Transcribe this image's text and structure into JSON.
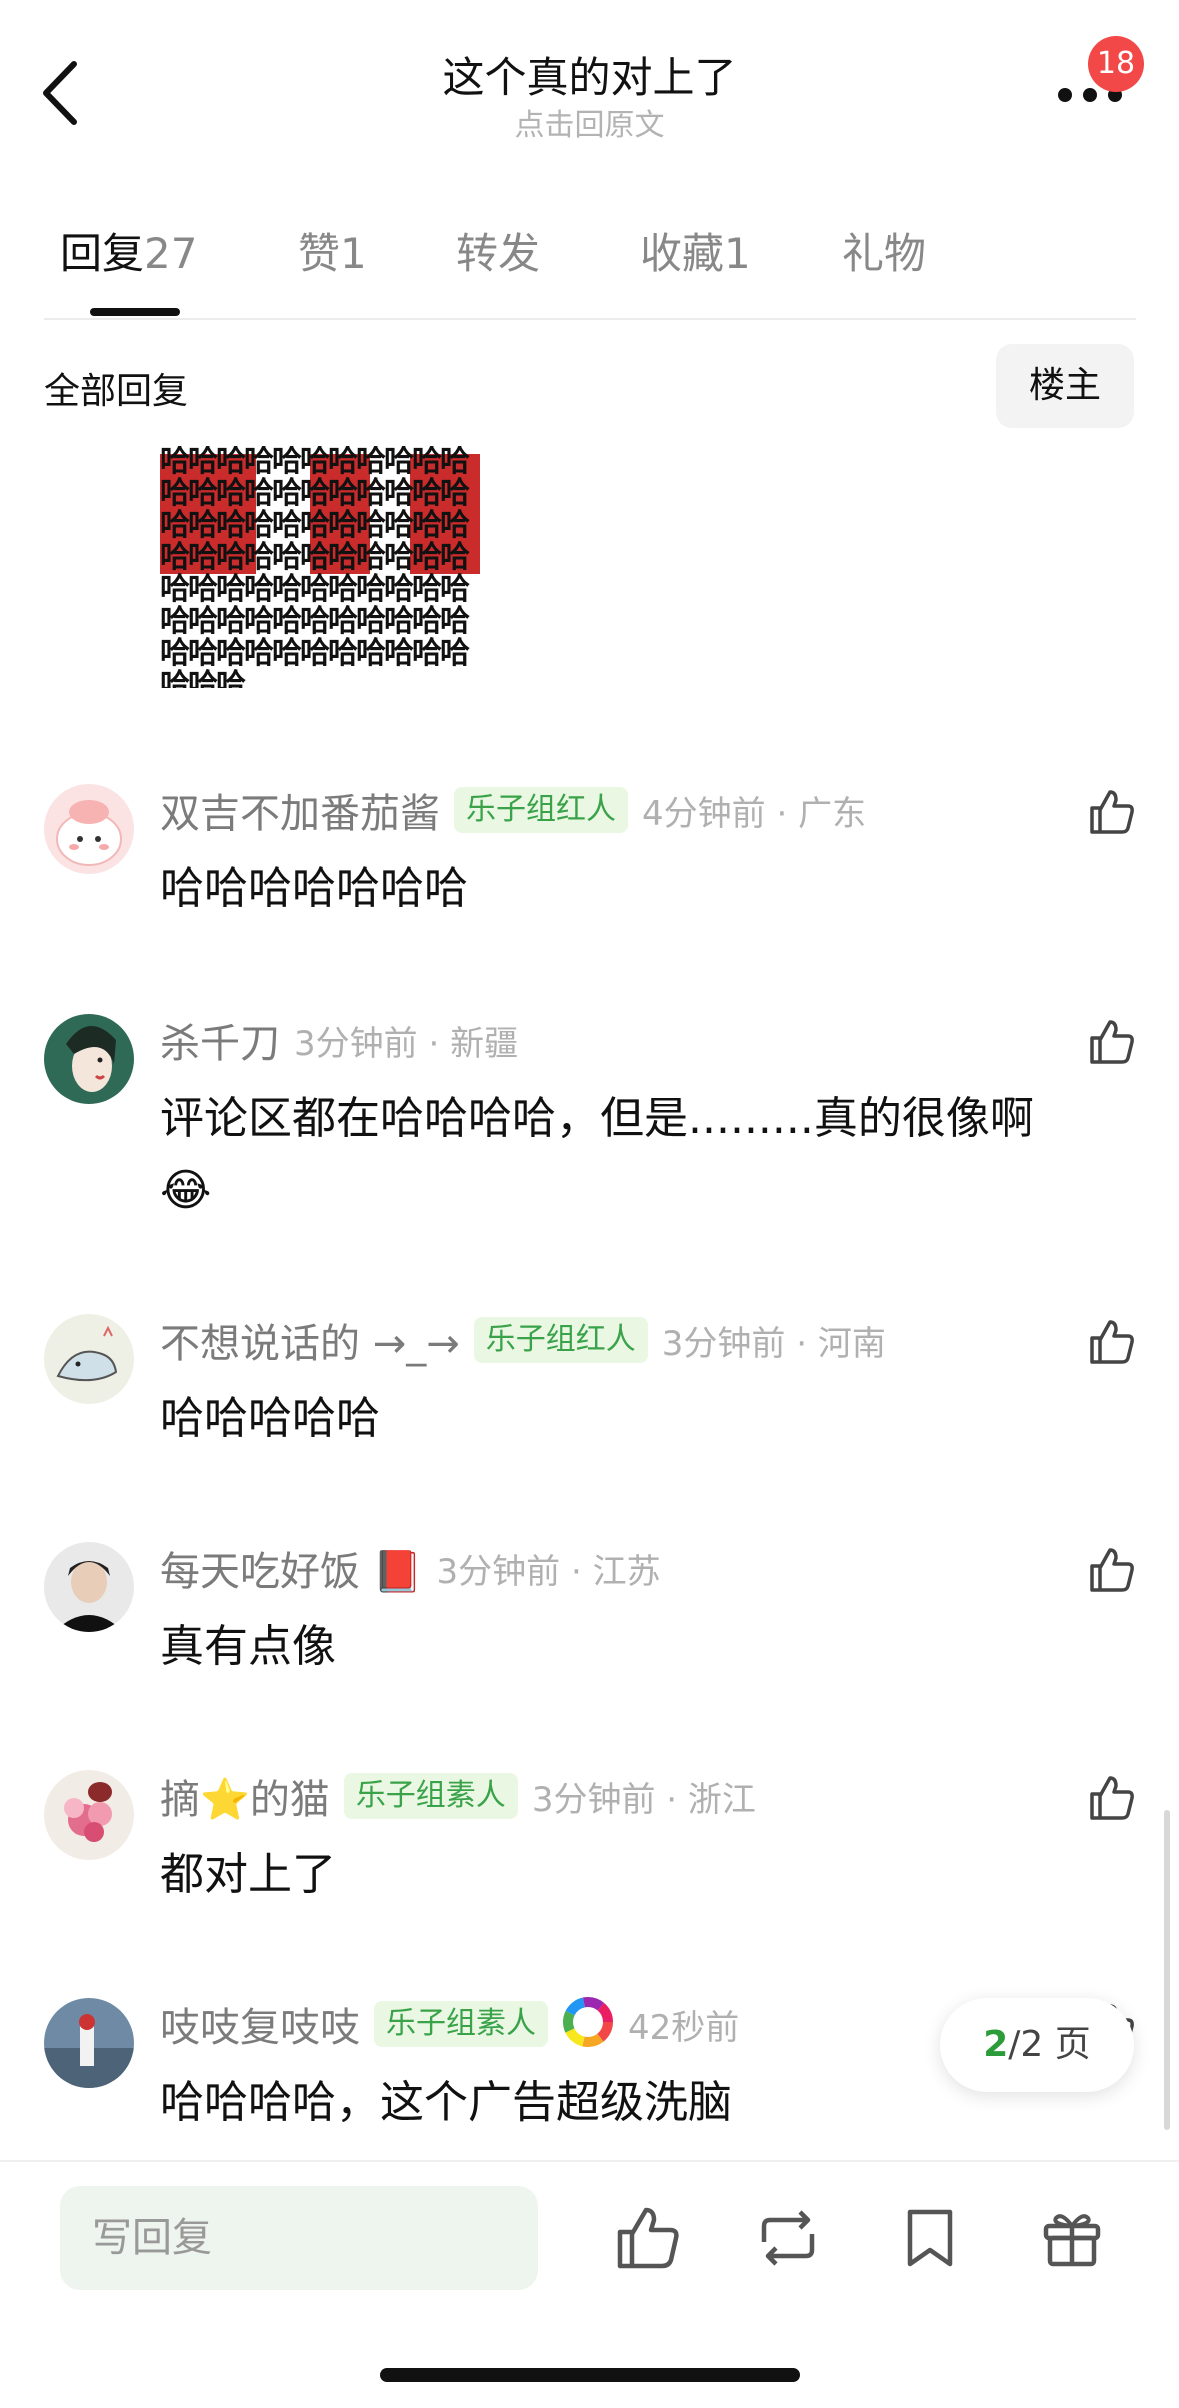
{
  "header": {
    "title": "这个真的对上了",
    "subtitle": "点击回原文",
    "notification_count": "18"
  },
  "tabs": [
    {
      "label": "回复",
      "count": "27",
      "active": true
    },
    {
      "label": "赞",
      "count": "1",
      "active": false
    },
    {
      "label": "转发",
      "count": "",
      "active": false
    },
    {
      "label": "收藏",
      "count": "1",
      "active": false
    },
    {
      "label": "礼物",
      "count": "",
      "active": false
    }
  ],
  "section": {
    "label": "全部回复",
    "op_filter": "楼主"
  },
  "meme_image": {
    "text_char": "哈",
    "accent_color": "#c41414"
  },
  "comments": [
    {
      "username": "双吉不加番茄酱",
      "tag": "乐子组红人",
      "time": "4分钟前",
      "location": "广东",
      "text": "哈哈哈哈哈哈哈",
      "avatar": "cartoon-character-avatar"
    },
    {
      "username": "杀千刀",
      "tag": "",
      "time": "3分钟前",
      "location": "新疆",
      "text": "评论区都在哈哈哈哈，但是.........真的很像啊",
      "emoji": "😂",
      "avatar": "illustrated-portrait-avatar"
    },
    {
      "username": "不想说话的 →_→",
      "tag": "乐子组红人",
      "time": "3分钟前",
      "location": "河南",
      "text": "哈哈哈哈哈",
      "avatar": "doodle-avatar"
    },
    {
      "username": "每天吃好饭",
      "username_emoji": "📕",
      "tag": "",
      "time": "3分钟前",
      "location": "江苏",
      "text": "真有点像",
      "avatar": "photo-avatar"
    },
    {
      "username_prefix": "摘",
      "username_emoji": "⭐",
      "username_suffix": "的猫",
      "tag": "乐子组素人",
      "time": "3分钟前",
      "location": "浙江",
      "text": "都对上了",
      "avatar": "flower-bouquet-avatar"
    },
    {
      "username": "吱吱复吱吱",
      "tag": "乐子组素人",
      "badge_icon": "rainbow-ring-badge",
      "time": "42秒前",
      "location": "",
      "text": "哈哈哈哈，这个广告超级洗脑",
      "avatar": "landscape-photo-avatar"
    }
  ],
  "pagination": {
    "current": "2",
    "total": "/2 页"
  },
  "bottom_bar": {
    "reply_placeholder": "写回复",
    "icons": [
      "like-icon",
      "repost-icon",
      "bookmark-icon",
      "gift-icon"
    ]
  },
  "colors": {
    "tag_bg": "#e9f7e3",
    "tag_text": "#3aa34a",
    "badge_red": "#f24848",
    "page_green": "#2c9b3a"
  }
}
